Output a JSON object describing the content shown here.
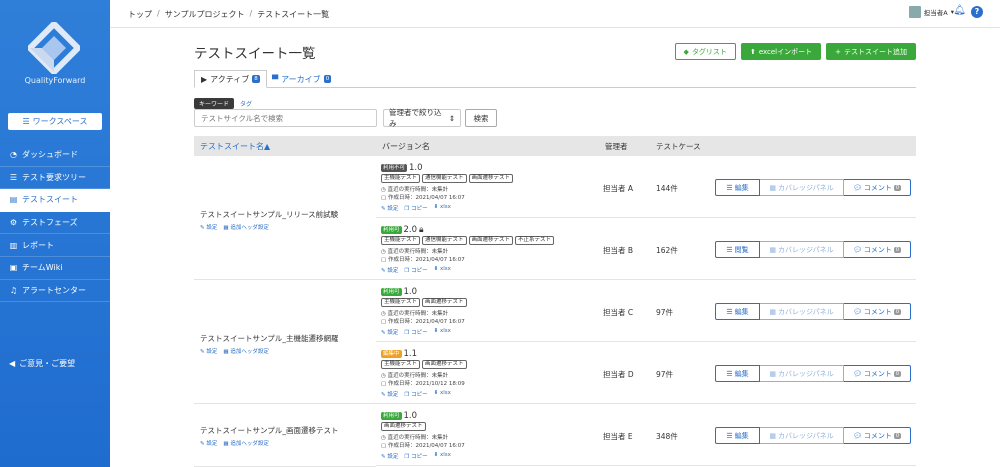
{
  "sidebar": {
    "logo_text": "QualityForward",
    "workspace_label": "ワークスペース",
    "items": [
      {
        "label": "ダッシュボード"
      },
      {
        "label": "テスト要求ツリー"
      },
      {
        "label": "テストスイート"
      },
      {
        "label": "テストフェーズ"
      },
      {
        "label": "レポート"
      },
      {
        "label": "チームWiki"
      },
      {
        "label": "アラートセンター"
      }
    ],
    "feedback_label": "ご意見・ご要望"
  },
  "topbar": {
    "breadcrumb": [
      "トップ",
      "サンプルプロジェクト",
      "テストスイート一覧"
    ],
    "user_name": "担当者A"
  },
  "page": {
    "title": "テストスイート一覧",
    "buttons": {
      "tag_list": "タグリスト",
      "excel_import": "excelインポート",
      "add_suite": "テストスイート追加"
    },
    "tabs": [
      {
        "label": "アクティブ",
        "count": "8"
      },
      {
        "label": "アーカイブ",
        "count": "0"
      }
    ],
    "filter": {
      "keyword_tab": "キーワード",
      "tag_tab": "タグ",
      "search_placeholder": "テストサイクル名で検索",
      "owner_filter": "管理者で絞り込み",
      "search_button": "検索"
    },
    "table": {
      "headers": {
        "suite": "テストスイート名▲",
        "version": "バージョン名",
        "owner": "管理者",
        "cases": "テストケース"
      },
      "suite_links": {
        "settings": "設定",
        "header_settings": "追加ヘッダ設定"
      },
      "version_links": {
        "settings": "設定",
        "copy": "コピー",
        "xlsx": "xlsx"
      },
      "suites": [
        {
          "name": "テストスイートサンプル_リリース前試験"
        },
        {
          "name": "テストスイートサンプル_主機能遷移網羅"
        },
        {
          "name": "テストスイートサンプル_画面遷移テスト"
        }
      ],
      "rows": [
        {
          "status": "利用不可",
          "version": "1.0",
          "tags": [
            "主機能テスト",
            "通信機能テスト",
            "画面遷移テスト"
          ],
          "last_run": "直近の実行時間：未集計",
          "created": "作成日時：2021/04/07 16:07",
          "owner": "担当者 A",
          "cases": "144件",
          "action1": "編集",
          "action2": "カバレッジパネル",
          "action3": "コメント",
          "comment_count": "0"
        },
        {
          "status": "利用可",
          "version": "2.0",
          "tags": [
            "主機能テスト",
            "通信機能テスト",
            "画面遷移テスト",
            "不正系テスト"
          ],
          "last_run": "直近の実行時間：未集計",
          "created": "作成日時：2021/04/07 16:07",
          "owner": "担当者 B",
          "cases": "162件",
          "action1": "閲覧",
          "action2": "カバレッジパネル",
          "action3": "コメント",
          "comment_count": "0"
        },
        {
          "status": "利用可",
          "version": "1.0",
          "tags": [
            "主機能テスト",
            "画面遷移テスト"
          ],
          "last_run": "直近の実行時間：未集計",
          "created": "作成日時：2021/04/07 16:07",
          "owner": "担当者 C",
          "cases": "97件",
          "action1": "編集",
          "action2": "カバレッジパネル",
          "action3": "コメント",
          "comment_count": "0"
        },
        {
          "status": "編集中",
          "version": "1.1",
          "tags": [
            "主機能テスト",
            "画面遷移テスト"
          ],
          "last_run": "直近の実行時間：未集計",
          "created": "作成日時：2021/10/12 18:09",
          "owner": "担当者 D",
          "cases": "97件",
          "action1": "編集",
          "action2": "カバレッジパネル",
          "action3": "コメント",
          "comment_count": "0"
        },
        {
          "status": "利用可",
          "version": "1.0",
          "tags": [
            "画面遷移テスト"
          ],
          "last_run": "直近の実行時間：未集計",
          "created": "作成日時：2021/04/07 16:07",
          "owner": "担当者 E",
          "cases": "348件",
          "action1": "編集",
          "action2": "カバレッジパネル",
          "action3": "コメント",
          "comment_count": "0"
        }
      ]
    }
  },
  "colors": {
    "sidebar": "#2f7fd9",
    "accent": "#2a6fc9",
    "green": "#3aa83a",
    "orange": "#f0a020"
  }
}
